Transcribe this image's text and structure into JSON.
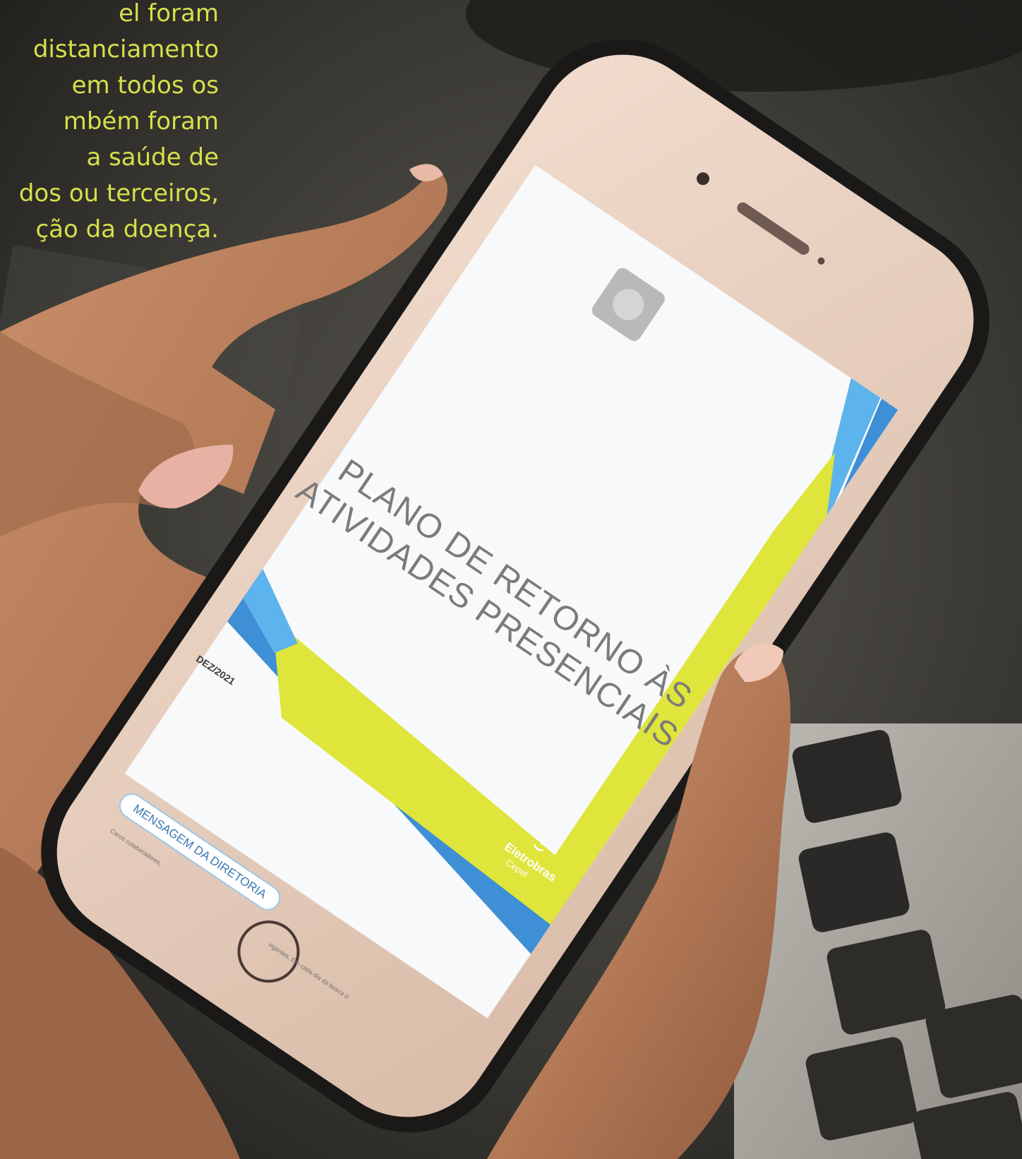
{
  "overlay_text": {
    "lines": [
      "el foram",
      "distanciamento",
      "em todos os",
      "mbém foram",
      "a saúde de",
      "dos ou terceiros,",
      "ção da doença."
    ]
  },
  "phone_screen": {
    "document_title_line1": "PLANO DE RETORNO ÀS",
    "document_title_line2": "ATIVIDADES PRESENCIAIS",
    "date": "DEZ/2021",
    "section_button": "MENSAGEM DA DIRETORIA",
    "body_line_1": "Caros colaboradores,",
    "body_line_2": "vigentes. Em cada dia da busca d",
    "brand_name": "Eletrobras",
    "brand_sub": "Cepel"
  },
  "colors": {
    "overlay_text": "#d6e04a",
    "accent_yellow": "#dfe53a",
    "accent_blue": "#3e8fd6",
    "accent_light_blue": "#5db3ec",
    "screen_white": "#f7f9fb",
    "background_dark": "#2f2d29"
  }
}
